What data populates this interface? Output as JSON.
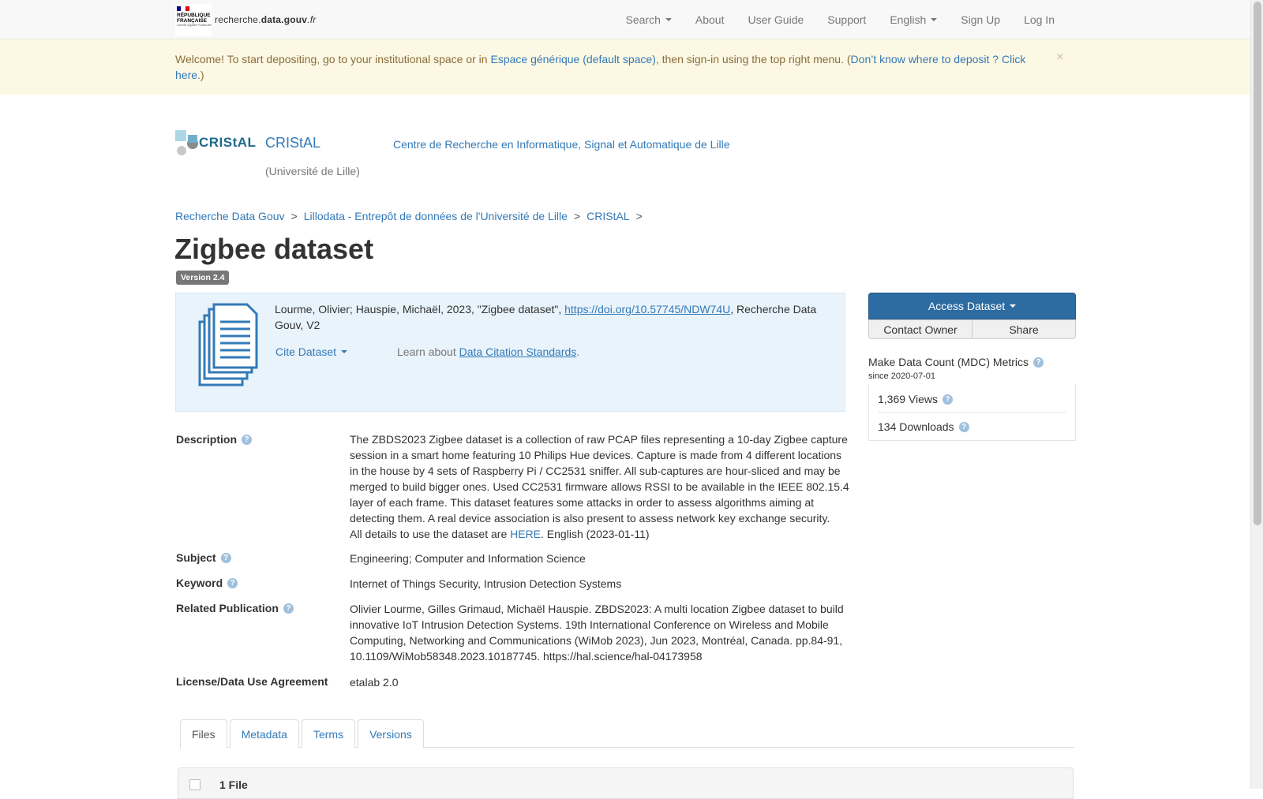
{
  "navbar": {
    "logo_rf_line1": "RÉPUBLIQUE",
    "logo_rf_line2": "FRANÇAISE",
    "logo_motto": "Liberté Égalité Fraternité",
    "site_prefix": "recherche.",
    "site_bold": "data.gouv",
    "site_suffix": ".fr",
    "items": {
      "search": "Search",
      "about": "About",
      "user_guide": "User Guide",
      "support": "Support",
      "language": "English",
      "sign_up": "Sign Up",
      "log_in": "Log In"
    }
  },
  "alert": {
    "part1": "Welcome! To start depositing, go to your institutional space or in ",
    "link1": "Espace générique (default space)",
    "part2": ", then sign-in using the top right menu. (",
    "link2": "Don’t know where to deposit ? Click here.",
    "part3": ")",
    "close": "×"
  },
  "dataverse": {
    "logo_text": "CRIStAL",
    "name": "CRIStAL",
    "affiliation": "(Université de Lille)",
    "tagline": "Centre de Recherche en Informatique, Signal et Automatique de Lille"
  },
  "breadcrumb": {
    "items": [
      "Recherche Data Gouv",
      "Lillodata - Entrepôt de données de l'Université de Lille",
      "CRIStAL"
    ],
    "separator": ">"
  },
  "dataset": {
    "title": "Zigbee dataset",
    "version": "Version 2.4"
  },
  "citation": {
    "text_before": "Lourme, Olivier; Hauspie, Michaël, 2023, \"Zigbee dataset\", ",
    "doi": "https://doi.org/10.57745/NDW74U",
    "text_after": ", Recherche Data Gouv, V2",
    "cite_button": "Cite Dataset",
    "learn_prefix": "Learn about ",
    "learn_link": "Data Citation Standards",
    "learn_suffix": "."
  },
  "actions": {
    "access": "Access Dataset",
    "contact": "Contact Owner",
    "share": "Share"
  },
  "metrics": {
    "title": "Make Data Count (MDC) Metrics",
    "since": "since 2020-07-01",
    "views": "1,369 Views",
    "downloads": "134 Downloads"
  },
  "metadata": {
    "description": {
      "label": "Description",
      "text": "The ZBDS2023 Zigbee dataset is a collection of raw PCAP files representing a 10-day Zigbee capture session in a smart home featuring 10 Philips Hue devices. Capture is made from 4 different locations in the house by 4 sets of Raspberry Pi / CC2531 sniffer. All sub-captures are hour-sliced and may be merged to build bigger ones. Used CC2531 firmware allows RSSI to be available in the IEEE 802.15.4 layer of each frame. This dataset features some attacks in order to assess algorithms aiming at detecting them. A real device association is also present to assess network key exchange security.",
      "details_prefix": "All details to use the dataset are ",
      "details_link": "HERE",
      "details_suffix": ". English (2023-01-11)"
    },
    "subject": {
      "label": "Subject",
      "value": "Engineering; Computer and Information Science"
    },
    "keyword": {
      "label": "Keyword",
      "value": "Internet of Things Security, Intrusion Detection Systems"
    },
    "related_publication": {
      "label": "Related Publication",
      "value": "Olivier Lourme, Gilles Grimaud, Michaël Hauspie. ZBDS2023: A multi location Zigbee dataset to build innovative IoT Intrusion Detection Systems. 19th International Conference on Wireless and Mobile Computing, Networking and Communications (WiMob 2023), Jun 2023, Montréal, Canada. pp.84-91, 10.1109/WiMob58348.2023.10187745. https://hal.science/hal-04173958"
    },
    "license": {
      "label": "License/Data Use Agreement",
      "value": "etalab 2.0"
    }
  },
  "tabs": [
    "Files",
    "Metadata",
    "Terms",
    "Versions"
  ],
  "files": {
    "count_label": "1 File"
  },
  "colors": {
    "link": "#337ab7",
    "primary_button": "#2d6ca2",
    "alert_bg": "#fcf8e3",
    "citation_bg": "#e9f3fb"
  },
  "help_icon": "?"
}
